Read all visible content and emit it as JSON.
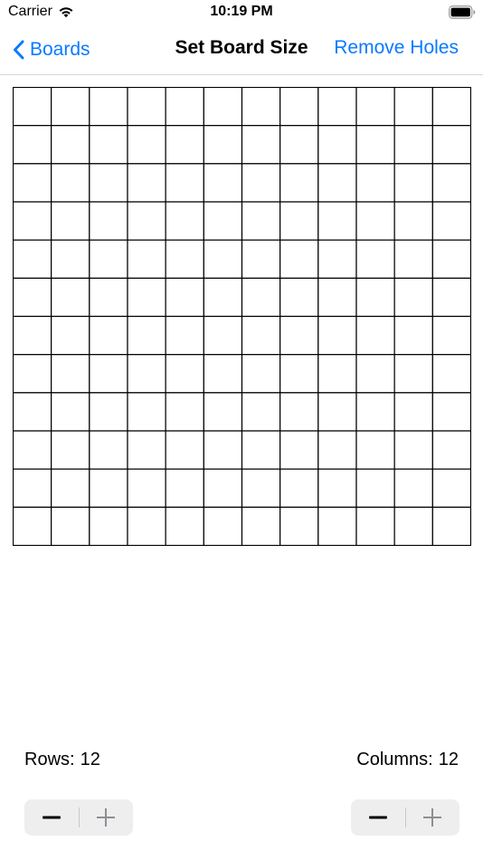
{
  "status_bar": {
    "carrier": "Carrier",
    "time": "10:19 PM"
  },
  "nav": {
    "back_label": "Boards",
    "title": "Set Board Size",
    "right_button_label": "Remove Holes"
  },
  "board": {
    "rows": 12,
    "columns": 12
  },
  "controls": {
    "rows_label": "Rows:",
    "rows_value": "12",
    "columns_label": "Columns:",
    "columns_value": "12"
  },
  "colors": {
    "accent": "#0a7aff",
    "grid_line": "#000000",
    "stepper_bg": "#eeeeef"
  },
  "icons": {
    "wifi": "wifi-icon",
    "battery": "battery-icon",
    "back": "chevron-left-icon",
    "decrement": "minus-icon",
    "increment": "plus-icon"
  }
}
